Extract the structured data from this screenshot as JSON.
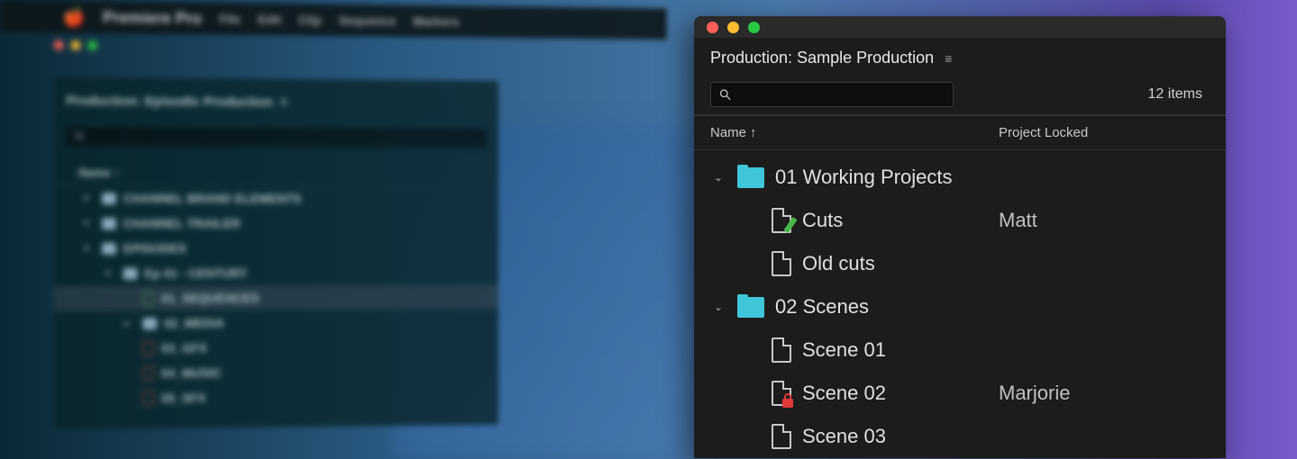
{
  "background": {
    "app_name": "Premiere Pro",
    "menubar": [
      "File",
      "Edit",
      "Clip",
      "Sequence",
      "Markers"
    ],
    "panel_title": "Production: Episodic Production",
    "col_name": "Name",
    "col_sort_indicator": "↑",
    "tree": [
      {
        "level": 1,
        "kind": "folder",
        "expanded": true,
        "label": "CHANNEL BRAND ELEMENTS"
      },
      {
        "level": 1,
        "kind": "folder",
        "expanded": true,
        "label": "CHANNEL TRAILER"
      },
      {
        "level": 1,
        "kind": "folder",
        "expanded": true,
        "label": "EPISODES"
      },
      {
        "level": 2,
        "kind": "folder",
        "expanded": true,
        "label": "Ep 01 - CENTURY"
      },
      {
        "level": 3,
        "kind": "file-green",
        "selected": true,
        "label": "01_SEQUENCES"
      },
      {
        "level": 3,
        "kind": "folder",
        "expanded": false,
        "label": "02_MEDIA"
      },
      {
        "level": 3,
        "kind": "file-red",
        "label": "03_GFX"
      },
      {
        "level": 3,
        "kind": "file-red",
        "label": "04_MUSIC"
      },
      {
        "level": 3,
        "kind": "file-red",
        "label": "05_SFX"
      }
    ]
  },
  "panel": {
    "title": "Production: Sample Production",
    "search_placeholder": "",
    "item_count": "12 items",
    "columns": {
      "name": "Name",
      "sort": "↑",
      "locked": "Project Locked"
    },
    "rows": [
      {
        "level": 1,
        "kind": "folder",
        "expanded": true,
        "label": "01 Working Projects",
        "locked_by": ""
      },
      {
        "level": 2,
        "kind": "file-editing",
        "label": "Cuts",
        "locked_by": "Matt"
      },
      {
        "level": 2,
        "kind": "file",
        "label": "Old cuts",
        "locked_by": ""
      },
      {
        "level": 1,
        "kind": "folder",
        "expanded": true,
        "label": "02 Scenes",
        "locked_by": ""
      },
      {
        "level": 2,
        "kind": "file",
        "label": "Scene 01",
        "locked_by": ""
      },
      {
        "level": 2,
        "kind": "file-locked",
        "label": "Scene 02",
        "locked_by": "Marjorie"
      },
      {
        "level": 2,
        "kind": "file",
        "label": "Scene 03",
        "locked_by": ""
      }
    ]
  }
}
